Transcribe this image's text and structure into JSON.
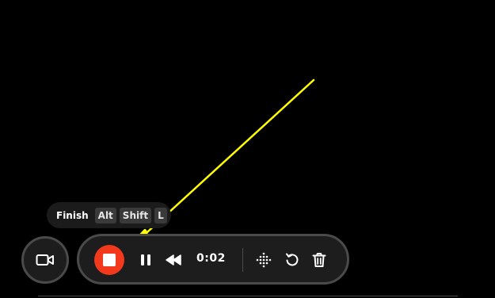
{
  "tooltip": {
    "label": "Finish",
    "keys": [
      "Alt",
      "Shift",
      "L"
    ]
  },
  "toolbar": {
    "timer": "0:02"
  },
  "icons": {
    "camera": "video-camera-icon",
    "stop": "stop-icon",
    "pause": "pause-icon",
    "rewind": "rewind-icon",
    "grid": "dot-grid-icon",
    "restart": "restart-icon",
    "delete": "trash-icon"
  },
  "colors": {
    "background": "#000000",
    "record_button": "#f2391b",
    "arrow": "#ffff00",
    "toolbar_bg": "#1d1d1d",
    "toolbar_border": "#4a4a4a"
  }
}
